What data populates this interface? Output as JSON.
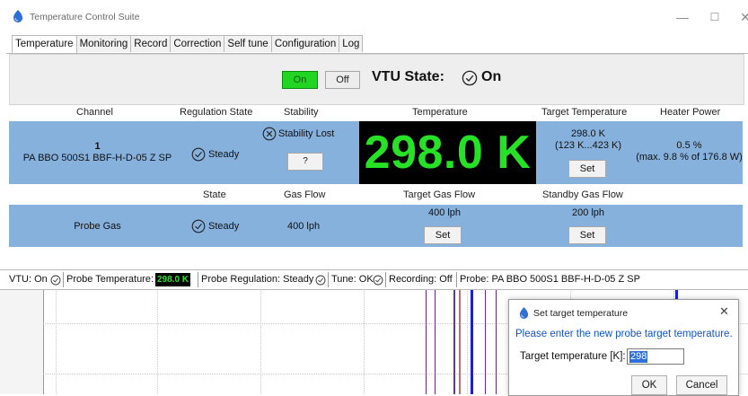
{
  "window": {
    "title": "Temperature Control Suite",
    "controls": {
      "minimize": "—",
      "maximize": "☐",
      "close": "✕"
    }
  },
  "tabs": [
    {
      "label": "Temperature",
      "active": true
    },
    {
      "label": "Monitoring",
      "active": false
    },
    {
      "label": "Record",
      "active": false
    },
    {
      "label": "Correction",
      "active": false
    },
    {
      "label": "Self tune",
      "active": false
    },
    {
      "label": "Configuration",
      "active": false
    },
    {
      "label": "Log",
      "active": false
    }
  ],
  "vtu": {
    "on_label": "On",
    "off_label": "Off",
    "state_label": "VTU State:",
    "state_value": "On",
    "on_color": "#22d522"
  },
  "channel_table": {
    "headers": {
      "channel": "Channel",
      "regulation_state": "Regulation State",
      "stability": "Stability",
      "temperature": "Temperature",
      "target_temperature": "Target Temperature",
      "heater_power": "Heater Power"
    },
    "row": {
      "channel_number": "1",
      "channel_name": "PA BBO 500S1 BBF-H-D-05 Z SP",
      "regulation_state": "Steady",
      "stability": "Stability Lost",
      "stability_help": "?",
      "temperature": "298.0 K",
      "target_temperature": "298.0 K",
      "target_range": "(123 K...423 K)",
      "set_label": "Set",
      "heater_power": "0.5 %",
      "heater_max": "(max. 9.8 % of 176.8 W)"
    }
  },
  "gas_table": {
    "headers": {
      "state": "State",
      "gas_flow": "Gas Flow",
      "target_gas_flow": "Target Gas Flow",
      "standby_gas_flow": "Standby Gas Flow"
    },
    "row": {
      "name": "Probe Gas",
      "state": "Steady",
      "gas_flow": "400 lph",
      "target_gas_flow": "400 lph",
      "target_set_label": "Set",
      "standby_gas_flow": "200 lph",
      "standby_set_label": "Set"
    }
  },
  "status_bar": {
    "vtu": "VTU: On",
    "probe_temp_label": "Probe Temperature:",
    "probe_temp_value": "298.0 K",
    "probe_regulation": "Probe Regulation: Steady",
    "tune": "Tune: OK",
    "recording": "Recording: Off",
    "probe": "Probe: PA BBO 500S1 BBF-H-D-05 Z SP"
  },
  "dialog": {
    "title": "Set target temperature",
    "close": "✕",
    "message": "Please enter the new probe target temperature.",
    "field_label": "Target temperature [K]:",
    "field_value": "298",
    "ok_label": "OK",
    "cancel_label": "Cancel"
  },
  "colors": {
    "row_blue": "#86b1dd",
    "display_bg": "#000000",
    "display_fg": "#26e126",
    "dialog_message": "#1255c8"
  }
}
